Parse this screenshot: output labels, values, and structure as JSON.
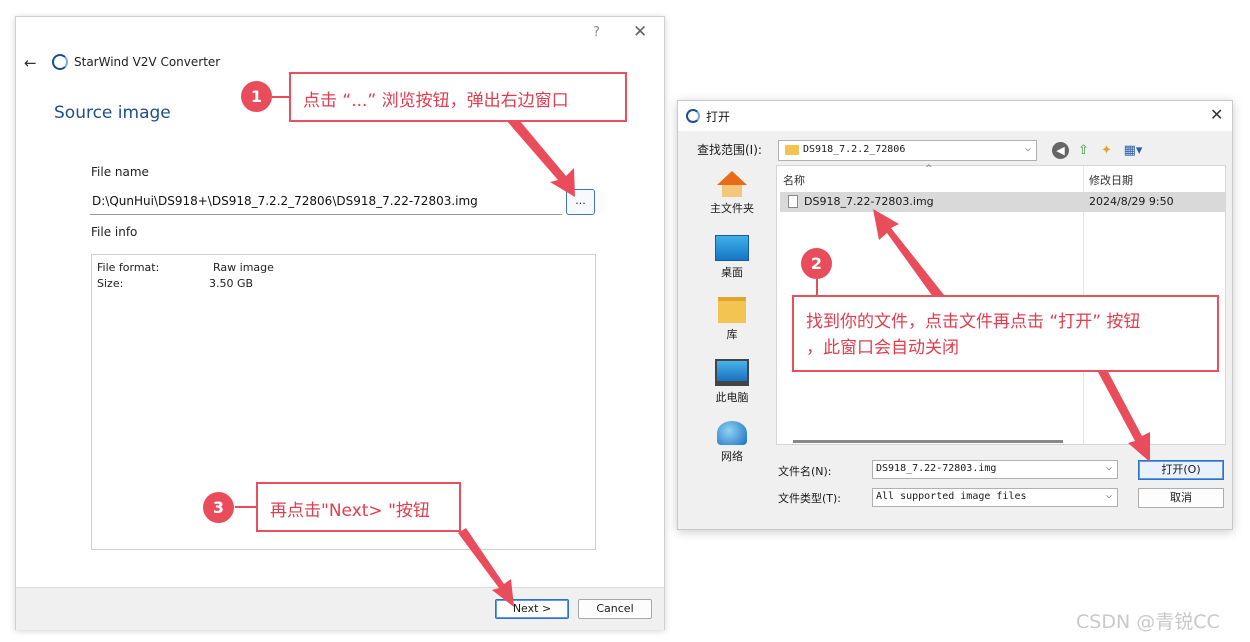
{
  "wizard": {
    "help": "?",
    "close": "✕",
    "back": "←",
    "app_title": "StarWind V2V Converter",
    "section_title": "Source image",
    "file_name_label": "File name",
    "file_path": "D:\\QunHui\\DS918+\\DS918_7.2.2_72806\\DS918_7.22-72803.img",
    "browse_label": "...",
    "file_info_label": "File info",
    "info": {
      "format_key": "File format:",
      "format_val": "Raw image",
      "size_key": "Size:",
      "size_val": "3.50 GB"
    },
    "next_label": "Next >",
    "cancel_label": "Cancel"
  },
  "dialog": {
    "title": "打开",
    "close": "✕",
    "look_in_label": "查找范围(I):",
    "look_in_value": "DS918_7.2.2_72806",
    "places": [
      {
        "label": "主文件夹",
        "icon": "home-icon"
      },
      {
        "label": "桌面",
        "icon": "desktop-icon"
      },
      {
        "label": "库",
        "icon": "library-icon"
      },
      {
        "label": "此电脑",
        "icon": "computer-icon"
      },
      {
        "label": "网络",
        "icon": "network-icon"
      }
    ],
    "columns": {
      "name": "名称",
      "modified": "修改日期"
    },
    "files": [
      {
        "name": "DS918_7.22-72803.img",
        "modified": "2024/8/29 9:50"
      }
    ],
    "filename_label": "文件名(N):",
    "filename_value": "DS918_7.22-72803.img",
    "filetype_label": "文件类型(T):",
    "filetype_value": "All supported image files",
    "open_label": "打开(O)",
    "cancel_label": "取消"
  },
  "annotations": {
    "step1_num": "1",
    "step1_text": "点击 “...” 浏览按钮，弹出右边窗口",
    "step2_num": "2",
    "step2_text_line1": "找到你的文件，点击文件再点击 “打开” 按钮",
    "step2_text_line2": "，此窗口会自动关闭",
    "step3_num": "3",
    "step3_text": "再点击\"Next> \"按钮"
  },
  "watermark": "CSDN @青锐CC",
  "colors": {
    "annotation_red": "#e94d5c",
    "section_blue": "#1f4e88",
    "primary_border": "#2a71d0"
  }
}
